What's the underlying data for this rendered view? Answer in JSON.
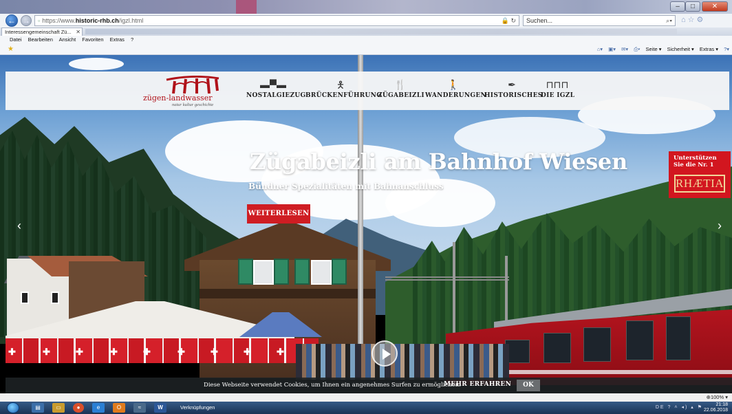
{
  "browser": {
    "url": "https://www.historic-rhb.ch/igzl.html",
    "url_prefix": "https://www.",
    "url_domain": "historic-rhb.ch",
    "url_path": "/igzl.html",
    "search_placeholder": "Suchen...",
    "tab_title": "Interessengemeinschaft Zü...",
    "menu": [
      "Datei",
      "Bearbeiten",
      "Ansicht",
      "Favoriten",
      "Extras",
      "?"
    ],
    "commands": [
      "Seite ▾",
      "Sicherheit ▾",
      "Extras ▾"
    ],
    "zoom": "100%"
  },
  "site": {
    "logo_name": "zügen-landwasser",
    "logo_tagline": "natur kultur geschichte",
    "nav": [
      {
        "label": "NOSTALGIEZUG",
        "icon": "locomotive-icon"
      },
      {
        "label": "BRÜCKENFÜHRUNG",
        "icon": "guide-icon"
      },
      {
        "label": "ZÜGABEIZLI",
        "icon": "cutlery-icon"
      },
      {
        "label": "WANDERUNGEN",
        "icon": "hiker-icon"
      },
      {
        "label": "HISTORISCHES",
        "icon": "quill-icon"
      },
      {
        "label": "DIE IGZL",
        "icon": "viaduct-icon"
      }
    ]
  },
  "hero": {
    "title": "Zügabeizli am Bahnhof Wiesen",
    "subtitle": "Bündner Spezialitäten mit Bahnanschluss",
    "button": "WEITERLESEN"
  },
  "support": {
    "text": "Unterstützen Sie die Nr. 1",
    "logo": "RHÆTIA"
  },
  "cookie": {
    "text": "Diese Webseite verwendet Cookies, um Ihnen ein angenehmes Surfen zu ermöglichen.",
    "more": "MEHR ERFAHREN",
    "ok": "OK"
  },
  "taskbar": {
    "label": "Verknüpfungen",
    "lang": "DE",
    "time": "21:18",
    "date": "22.06.2018"
  }
}
